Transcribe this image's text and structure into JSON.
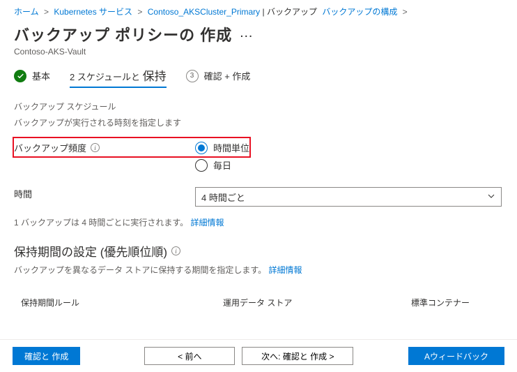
{
  "breadcrumb": {
    "home": "ホーム",
    "service": "Kubernetes サービス",
    "cluster": "Contoso_AKSCluster_Primary",
    "cluster_suffix": " | バックアップ",
    "config": "バックアップの構成"
  },
  "page": {
    "title": "バックアップ ポリシーの 作成",
    "subtitle": "Contoso-AKS-Vault"
  },
  "tabs": {
    "t1": "基本",
    "t2_prefix": "2 スケジュールと",
    "t2_retain": "保持",
    "t3_num": "3",
    "t3": "確認 + 作成"
  },
  "schedule": {
    "section_title": "バックアップ スケジュール",
    "section_desc": "バックアップが実行される時刻を指定します",
    "freq_label": "バックアップ頻度",
    "opt_hourly": "時間単位",
    "opt_daily": "毎日",
    "time_label": "時間",
    "time_value": "4 時間ごと",
    "note_text": "1 バックアップは 4 時間ごとに実行されます。",
    "note_link": "詳細情報"
  },
  "retention": {
    "title": "保持期間の設定 (優先順位順)",
    "desc_text": "バックアップを異なるデータ ストアに保持する期間を指定します。",
    "desc_link": "詳細情報",
    "col1": "保持期間ルール",
    "col2": "運用データ ストア",
    "col3": "標準コンテナー"
  },
  "footer": {
    "review": "確認と 作成",
    "prev": "< 前へ",
    "next": "次へ: 確認と 作成 >",
    "feedback": "Aウィードバック"
  }
}
